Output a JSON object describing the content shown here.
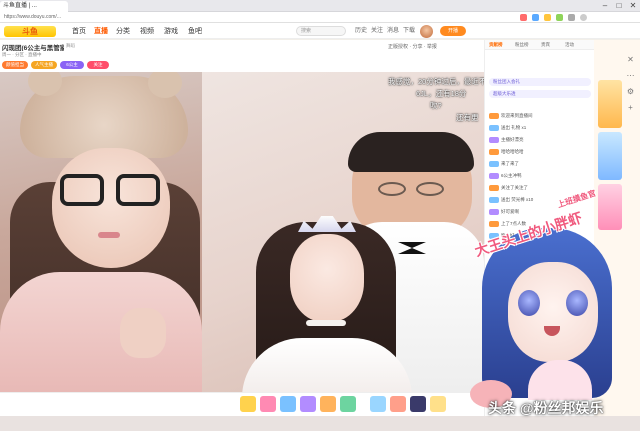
{
  "browser": {
    "tab_title": "斗鱼直播 | ...",
    "url": "https://www.douyu.com/...",
    "win_min": "–",
    "win_max": "□",
    "win_close": "✕"
  },
  "header": {
    "logo_text": "斗鱼",
    "nav": [
      "首页",
      "直播",
      "分类",
      "视频",
      "游戏",
      "鱼吧"
    ],
    "active_nav": "直播",
    "search_placeholder": "搜索",
    "icons": [
      "历史",
      "关注",
      "消息",
      "下载"
    ],
    "open_live": "开播"
  },
  "room": {
    "title": "闪现团(6公主与黑管家)",
    "tag": "舞蹈",
    "meta": "周一 · 分区 · 直播中",
    "badges": [
      {
        "label": "颜值担当",
        "color": "#ff7a2f"
      },
      {
        "label": "人气主播",
        "color": "#f5a623"
      },
      {
        "label": "6公主",
        "color": "#8a63f5"
      },
      {
        "label": "关注",
        "color": "#ff4d6a"
      }
    ],
    "right_text": "正版授权 · 分享 · 举报"
  },
  "video": {
    "subtitles": [
      "我感觉，20分钟过后，最近不",
      "6JL，还有18分",
      "吹?",
      "还有更"
    ]
  },
  "chat": {
    "tabs": [
      "贡献榜",
      "粉丝榜",
      "贵宾",
      "活动"
    ],
    "active_tab": "贡献榜",
    "ranks": [
      "粉丝团入会礼",
      "超级大乐透"
    ],
    "messages": [
      "欢迎来到直播间",
      "送出 礼物 x1",
      "主播好漂亮",
      "哈哈哈哈哈",
      "来了来了",
      "6公主冲鸭",
      "关注了关注了",
      "送出 荧光棒 x10",
      "好可爱啊",
      "上了7点人数",
      "晚上好"
    ]
  },
  "side": {
    "icons": [
      "✕",
      "⋯",
      "⚙",
      "+"
    ]
  },
  "overlay": {
    "vtuber_text_small": "上班摸鱼官",
    "vtuber_text_big": "大王头上的小胖虾",
    "watermark": "头条 @粉丝邦娱乐"
  },
  "colors": {
    "accent": "#ff5a00",
    "chat_lv1": "#ff9a3c",
    "chat_lv2": "#7ac1ff",
    "chat_lv3": "#b28cff"
  }
}
